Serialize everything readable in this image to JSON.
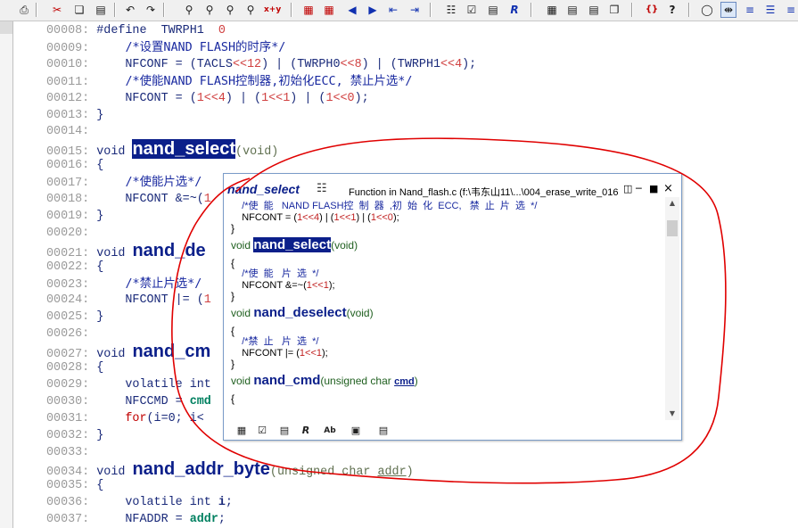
{
  "toolbar": {
    "icons": [
      "print-icon",
      "cut-icon",
      "copy-icon",
      "paste-icon",
      "undo-icon",
      "redo-icon",
      "find-icon",
      "find-prev-icon",
      "find-next-icon",
      "find-files-icon",
      "replace-icon",
      "bookmark-toggle-icon",
      "bookmark-next-icon",
      "back-icon",
      "forward-icon",
      "jump-back-icon",
      "jump-forward-icon",
      "symbol-window-icon",
      "lookup-icon",
      "relation-icon",
      "browse-icon",
      "panel-1-icon",
      "panel-2-icon",
      "panel-3-icon",
      "panel-4-icon",
      "match-brace-icon",
      "context-help-icon",
      "show-hide-icon",
      "sync-icon",
      "outline-icon",
      "overview-icon"
    ],
    "labels": {
      "replace": "x+y",
      "match": "{}",
      "help": "?"
    }
  },
  "code": {
    "lines": [
      {
        "n": "00008:",
        "parts": [
          [
            "pp",
            "#define  "
          ],
          [
            "kw",
            "TWRPH1  "
          ],
          [
            "num",
            "0"
          ]
        ]
      },
      {
        "n": "00009:",
        "parts": [
          [
            "cm",
            "    /*设置NAND FLASH的时序*/"
          ]
        ]
      },
      {
        "n": "00010:",
        "parts": [
          [
            "kw",
            "    NFCONF = ("
          ],
          [
            "kw",
            "TACLS"
          ],
          [
            "num",
            "<<12"
          ],
          [
            "kw",
            ") | ("
          ],
          [
            "kw",
            "TWRPH0"
          ],
          [
            "num",
            "<<8"
          ],
          [
            "kw",
            ") | ("
          ],
          [
            "kw",
            "TWRPH1"
          ],
          [
            "num",
            "<<4"
          ],
          [
            "kw",
            ");"
          ]
        ]
      },
      {
        "n": "00011:",
        "parts": [
          [
            "cm",
            "    /*使能NAND FLASH控制器,初始化ECC, 禁止片选*/"
          ]
        ]
      },
      {
        "n": "00012:",
        "parts": [
          [
            "kw",
            "    NFCONT = ("
          ],
          [
            "num",
            "1<<4"
          ],
          [
            "kw",
            ") | ("
          ],
          [
            "num",
            "1<<1"
          ],
          [
            "kw",
            ") | ("
          ],
          [
            "num",
            "1<<0"
          ],
          [
            "kw",
            ");"
          ]
        ]
      },
      {
        "n": "00013:",
        "parts": [
          [
            "kw",
            "}"
          ]
        ]
      },
      {
        "n": "00014:",
        "parts": []
      },
      {
        "n": "00015:",
        "parts": [
          [
            "kw",
            "void "
          ],
          [
            "fnhl",
            "nand_select"
          ],
          [
            "param",
            "(void)"
          ]
        ]
      },
      {
        "n": "00016:",
        "parts": [
          [
            "kw",
            "{"
          ]
        ]
      },
      {
        "n": "00017:",
        "parts": [
          [
            "cm",
            "    /*使能片选*/"
          ]
        ]
      },
      {
        "n": "00018:",
        "parts": [
          [
            "kw",
            "    NFCONT &=~("
          ],
          [
            "num",
            "1"
          ]
        ]
      },
      {
        "n": "00019:",
        "parts": [
          [
            "kw",
            "}"
          ]
        ]
      },
      {
        "n": "00020:",
        "parts": []
      },
      {
        "n": "00021:",
        "parts": [
          [
            "kw",
            "void "
          ],
          [
            "fn",
            "nand_de"
          ]
        ]
      },
      {
        "n": "00022:",
        "parts": [
          [
            "kw",
            "{"
          ]
        ]
      },
      {
        "n": "00023:",
        "parts": [
          [
            "cm",
            "    /*禁止片选*/"
          ]
        ]
      },
      {
        "n": "00024:",
        "parts": [
          [
            "kw",
            "    NFCONT |= ("
          ],
          [
            "num",
            "1"
          ]
        ]
      },
      {
        "n": "00025:",
        "parts": [
          [
            "kw",
            "}"
          ]
        ]
      },
      {
        "n": "00026:",
        "parts": []
      },
      {
        "n": "00027:",
        "parts": [
          [
            "kw",
            "void "
          ],
          [
            "fn",
            "nand_cm"
          ]
        ]
      },
      {
        "n": "00028:",
        "parts": [
          [
            "kw",
            "{"
          ]
        ]
      },
      {
        "n": "00029:",
        "parts": [
          [
            "kw",
            "    volatile int"
          ]
        ]
      },
      {
        "n": "00030:",
        "parts": [
          [
            "kw",
            "    NFCCMD = "
          ],
          [
            "id",
            "cmd"
          ]
        ]
      },
      {
        "n": "00031:",
        "parts": [
          [
            "kw2",
            "    for"
          ],
          [
            "kw",
            "(i=0; i<"
          ]
        ]
      },
      {
        "n": "00032:",
        "parts": [
          [
            "kw",
            "}"
          ]
        ]
      },
      {
        "n": "00033:",
        "parts": []
      },
      {
        "n": "00034:",
        "parts": [
          [
            "kw",
            "void "
          ],
          [
            "fn",
            "nand_addr_byte"
          ],
          [
            "param",
            "(unsigned char "
          ],
          [
            "paramu",
            "addr"
          ],
          [
            "param",
            ")"
          ]
        ]
      },
      {
        "n": "00035:",
        "parts": [
          [
            "kw",
            "{"
          ]
        ]
      },
      {
        "n": "00036:",
        "parts": [
          [
            "kw",
            "    volatile int "
          ],
          [
            "kwb",
            "i"
          ],
          [
            "kw",
            ";"
          ]
        ]
      },
      {
        "n": "00037:",
        "parts": [
          [
            "kw",
            "    NFADDR = "
          ],
          [
            "id",
            "addr"
          ],
          [
            "kw",
            ";"
          ]
        ]
      }
    ]
  },
  "popup": {
    "symbol": "nand_select",
    "info": "Function in Nand_flash.c (f:\\韦东山11\\...\\004_erase_write_016",
    "lines": [
      {
        "parts": [
          [
            "cm2",
            "    /*使  能   NAND FLASH控  制  器  ,初  始  化  ECC,   禁  止  片  选  */"
          ]
        ]
      },
      {
        "parts": [
          [
            "t",
            "    NFCONT = ("
          ],
          [
            "num2",
            "1<<4"
          ],
          [
            "t",
            ") | ("
          ],
          [
            "num2",
            "1<<1"
          ],
          [
            "t",
            ") | ("
          ],
          [
            "num2",
            "1<<0"
          ],
          [
            "t",
            ");"
          ]
        ]
      },
      {
        "parts": [
          [
            "brace",
            "}"
          ]
        ]
      },
      {
        "parts": []
      },
      {
        "parts": [
          [
            "type",
            "void "
          ],
          [
            "fnphl",
            "nand_select"
          ],
          [
            "type",
            "(void)"
          ]
        ]
      },
      {
        "parts": []
      },
      {
        "parts": [
          [
            "brace",
            "{"
          ]
        ]
      },
      {
        "parts": [
          [
            "cm2",
            "    /*使  能   片  选  */"
          ]
        ]
      },
      {
        "parts": [
          [
            "t",
            "    NFCONT &=~("
          ],
          [
            "num2",
            "1<<1"
          ],
          [
            "t",
            ");"
          ]
        ]
      },
      {
        "parts": [
          [
            "brace",
            "}"
          ]
        ]
      },
      {
        "parts": []
      },
      {
        "parts": [
          [
            "type",
            "void "
          ],
          [
            "fnp",
            "nand_deselect"
          ],
          [
            "type",
            "(void)"
          ]
        ]
      },
      {
        "parts": []
      },
      {
        "parts": [
          [
            "brace",
            "{"
          ]
        ]
      },
      {
        "parts": [
          [
            "cm2",
            "    /*禁  止   片  选  */"
          ]
        ]
      },
      {
        "parts": [
          [
            "t",
            "    NFCONT |= ("
          ],
          [
            "num2",
            "1<<1"
          ],
          [
            "t",
            ");"
          ]
        ]
      },
      {
        "parts": [
          [
            "brace",
            "}"
          ]
        ]
      },
      {
        "parts": []
      },
      {
        "parts": [
          [
            "type",
            "void "
          ],
          [
            "fnp",
            "nand_cmd"
          ],
          [
            "type",
            "(unsigned char "
          ],
          [
            "pu",
            "cmd"
          ],
          [
            "type",
            ")"
          ]
        ]
      },
      {
        "parts": []
      },
      {
        "parts": [
          [
            "brace",
            "{"
          ]
        ]
      }
    ],
    "tools": [
      "lookup-icon",
      "context-help-icon",
      "browse-icon",
      "relation-icon",
      "font-size-icon",
      "lock-icon",
      "popup-settings-icon"
    ],
    "tool_labels": {
      "font": "Ab"
    }
  },
  "annotation": {
    "color": "#e00000"
  }
}
